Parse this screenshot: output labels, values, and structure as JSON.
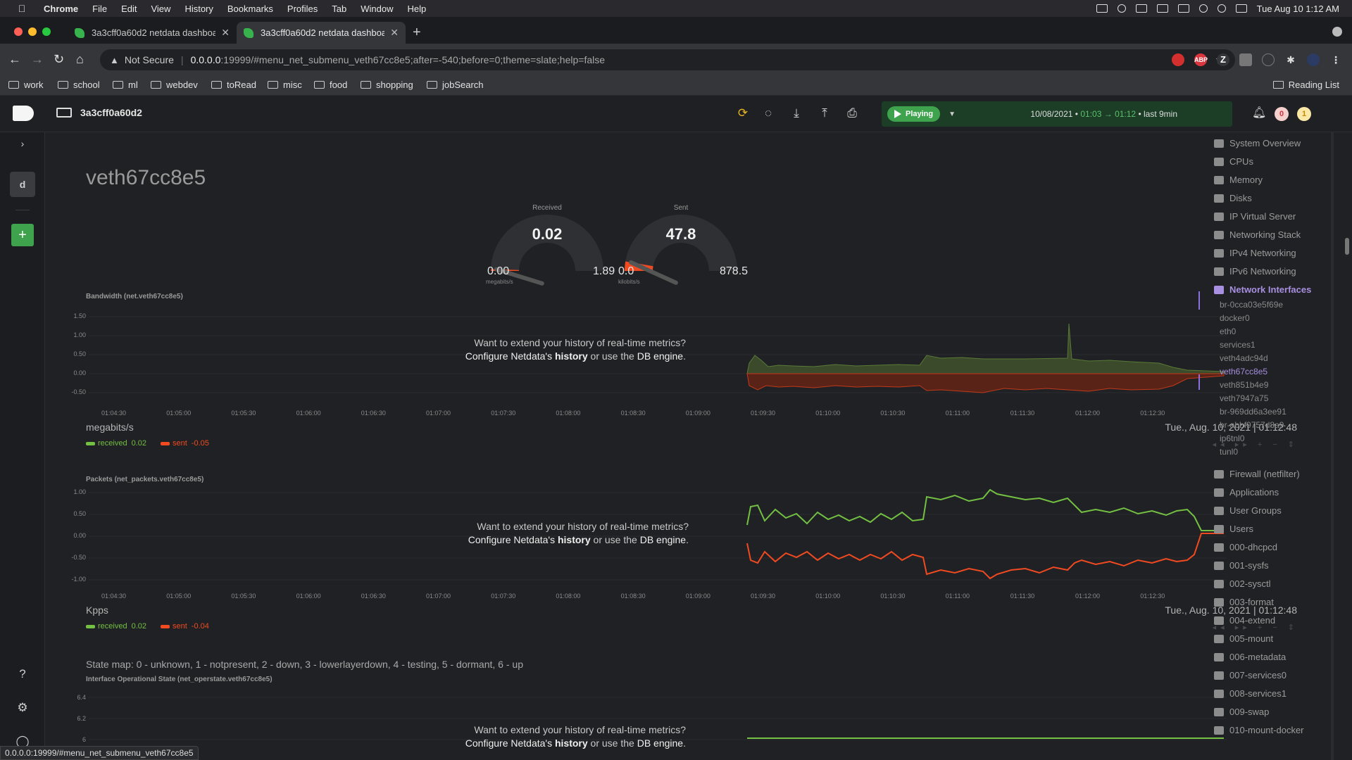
{
  "menubar": {
    "app": "Chrome",
    "items": [
      "File",
      "Edit",
      "View",
      "History",
      "Bookmarks",
      "Profiles",
      "Tab",
      "Window",
      "Help"
    ],
    "clock": "Tue Aug 10  1:12 AM"
  },
  "tabs": [
    {
      "title": "3a3cff0a60d2 netdata dashboard"
    },
    {
      "title": "3a3cff0a60d2 netdata dashboard"
    }
  ],
  "omnibox": {
    "security": "Not Secure",
    "host": "0.0.0.0",
    "path": ":19999/#menu_net_submenu_veth67cc8e5;after=-540;before=0;theme=slate;help=false"
  },
  "bookmarks": [
    "work",
    "school",
    "ml",
    "webdev",
    "toRead",
    "misc",
    "food",
    "shopping",
    "jobSearch"
  ],
  "reading_list": "Reading List",
  "netdata": {
    "hostname": "3a3cff0a60d2",
    "play_label": "Playing",
    "date": "10/08/2021",
    "from": "01:03",
    "to": "01:12",
    "last": "• last 9min",
    "badge_red": "0",
    "badge_yellow": "1",
    "rail_letter": "d"
  },
  "page": {
    "title": "veth67cc8e5",
    "gauge_received": {
      "label": "Received",
      "value": "0.02",
      "min": "0.00",
      "max": "1.89",
      "unit": "megabits/s",
      "fraction": 0.01
    },
    "gauge_sent": {
      "label": "Sent",
      "value": "47.8",
      "min": "0.0",
      "max": "878.5",
      "unit": "kilobits/s",
      "fraction": 0.054
    },
    "history_msg": {
      "line1": "Want to extend your history of real-time metrics?",
      "line2_a": "Configure Netdata's ",
      "line2_b": "history",
      "line2_c": " or use the ",
      "line2_d": "DB engine",
      "line2_e": "."
    },
    "bandwidth": {
      "title": "Bandwidth (net.veth67cc8e5)",
      "units": "megabits/s",
      "timestamp": "Tue., Aug. 10, 2021 | 01:12:48",
      "received_label": "received",
      "received_value": "0.02",
      "sent_label": "sent",
      "sent_value": "-0.05",
      "yticks": [
        "1.50",
        "1.00",
        "0.50",
        "0.00",
        "-0.50"
      ]
    },
    "packets": {
      "title": "Packets (net_packets.veth67cc8e5)",
      "units": "Kpps",
      "timestamp": "Tue., Aug. 10, 2021 | 01:12:48",
      "received_label": "received",
      "received_value": "0.02",
      "sent_label": "sent",
      "sent_value": "-0.04",
      "yticks": [
        "1.00",
        "0.50",
        "0.00",
        "-0.50",
        "-1.00"
      ]
    },
    "xticks": [
      "01:04:30",
      "01:05:00",
      "01:05:30",
      "01:06:00",
      "01:06:30",
      "01:07:00",
      "01:07:30",
      "01:08:00",
      "01:08:30",
      "01:09:00",
      "01:09:30",
      "01:10:00",
      "01:10:30",
      "01:11:00",
      "01:11:30",
      "01:12:00",
      "01:12:30"
    ],
    "state_map": "State map: 0 - unknown, 1 - notpresent, 2 - down, 3 - lowerlayerdown, 4 - testing, 5 - dormant, 6 - up",
    "operstate": {
      "title": "Interface Operational State (net_operstate.veth67cc8e5)",
      "yticks": [
        "6.4",
        "6.2",
        "6"
      ]
    }
  },
  "rightmenu": {
    "sections": [
      "System Overview",
      "CPUs",
      "Memory",
      "Disks",
      "IP Virtual Server",
      "Networking Stack",
      "IPv4 Networking",
      "IPv6 Networking",
      "Network Interfaces"
    ],
    "interfaces": [
      "br-0cca03e5f69e",
      "docker0",
      "eth0",
      "services1",
      "veth4adc94d",
      "veth67cc8e5",
      "veth851b4e9",
      "veth7947a75",
      "br-969dd6a3ee91",
      "br-abbf9757d8a9",
      "ip6tnl0",
      "tunl0"
    ],
    "more": [
      "Firewall (netfilter)",
      "Applications",
      "User Groups",
      "Users",
      "000-dhcpcd",
      "001-sysfs",
      "002-sysctl",
      "003-format",
      "004-extend",
      "005-mount",
      "006-metadata",
      "007-services0",
      "008-services1",
      "009-swap",
      "010-mount-docker"
    ]
  },
  "statusbar": "0.0.0.0:19999/#menu_net_submenu_veth67cc8e5"
}
